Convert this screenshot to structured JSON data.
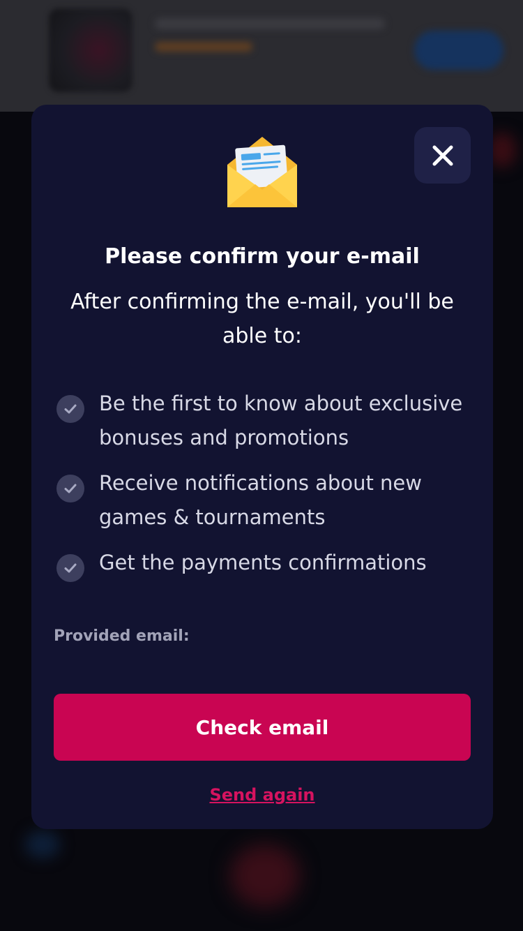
{
  "modal": {
    "title": "Please confirm your e-mail",
    "subtitle": "After confirming the e-mail, you'll be able to:",
    "benefits": [
      "Be the first to know about exclusive bonuses and promotions",
      "Receive notifications about new games & tournaments",
      "Get the payments confirmations"
    ],
    "provided_email_label": "Provided email:",
    "check_email_button": "Check email",
    "send_again_link": "Send again",
    "icons": {
      "envelope": "open-envelope-icon",
      "close": "close-icon",
      "check": "check-circle-icon"
    }
  },
  "colors": {
    "modal_bg": "#121331",
    "primary_button": "#c90552",
    "link": "#d6135f",
    "close_bg": "#1f2147"
  }
}
